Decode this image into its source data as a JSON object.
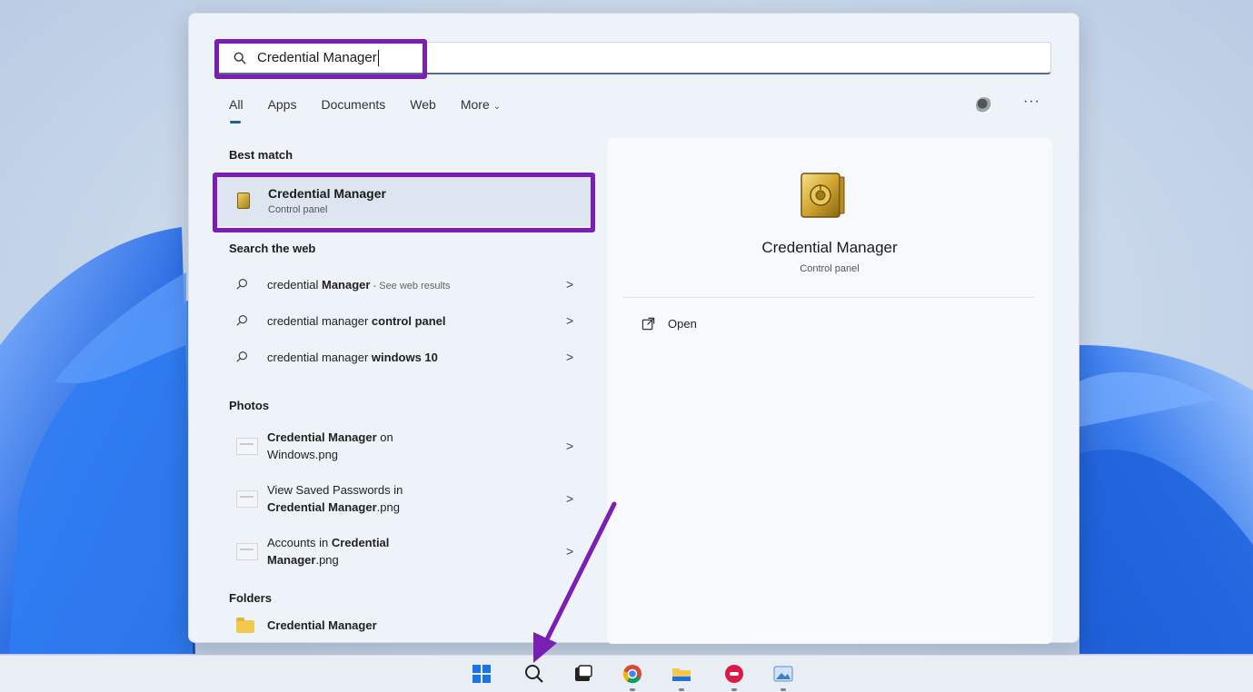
{
  "search": {
    "query": "Credential Manager"
  },
  "filters": {
    "all": "All",
    "apps": "Apps",
    "documents": "Documents",
    "web": "Web",
    "more": "More"
  },
  "menu": {
    "more_options": "···"
  },
  "sections": {
    "best_match": "Best match",
    "search_web": "Search the web",
    "photos": "Photos",
    "folders": "Folders"
  },
  "best_match": {
    "title": "Credential Manager",
    "subtitle": "Control panel"
  },
  "web_results": [
    {
      "prefix": "credential ",
      "bold": "Manager",
      "hint": " - See web results"
    },
    {
      "prefix": "credential manager ",
      "bold": "control panel",
      "hint": ""
    },
    {
      "prefix": "credential manager ",
      "bold": "windows 10",
      "hint": ""
    }
  ],
  "photos": [
    {
      "line1_bold": "Credential Manager",
      "line1_rest": " on",
      "line2": "Windows.png"
    },
    {
      "line1": "View Saved Passwords in",
      "line2_bold": "Credential Manager",
      "line2_rest": ".png"
    },
    {
      "line1": "Accounts in ",
      "line1_bold": "Credential",
      "line2_bold": "Manager",
      "line2_rest": ".png"
    }
  ],
  "folder": {
    "name": "Credential Manager"
  },
  "preview": {
    "title": "Credential Manager",
    "subtitle": "Control panel",
    "action_open": "Open"
  },
  "arrow_glyph": ">",
  "colors": {
    "highlight": "#7b1fb4",
    "accent": "#1f5f8b"
  },
  "taskbar": {
    "icons": [
      "windows-start-icon",
      "search-icon",
      "task-view-icon",
      "chrome-icon",
      "file-explorer-icon",
      "app-icon",
      "photos-icon"
    ]
  }
}
